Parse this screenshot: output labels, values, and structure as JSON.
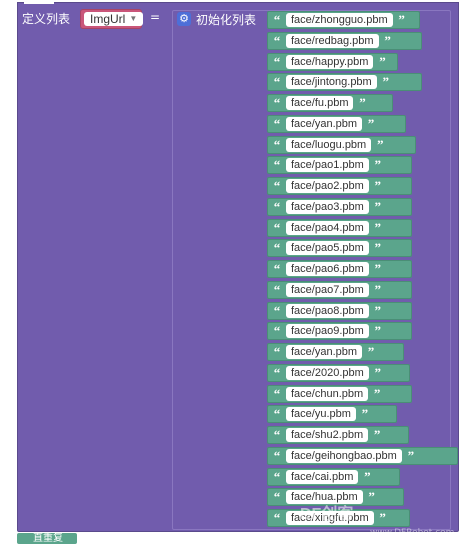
{
  "header": {
    "define_list_label": "定义列表",
    "variable_name": "ImgUrl",
    "equals": "=",
    "init_list_label": "初始化列表"
  },
  "items": [
    "face/zhongguo.pbm",
    "face/redbag.pbm",
    "face/happy.pbm",
    "face/jintong.pbm",
    "face/fu.pbm",
    "face/yan.pbm",
    "face/luogu.pbm",
    "face/pao1.pbm",
    "face/pao2.pbm",
    "face/pao3.pbm",
    "face/pao4.pbm",
    "face/pao5.pbm",
    "face/pao6.pbm",
    "face/pao7.pbm",
    "face/pao8.pbm",
    "face/pao9.pbm",
    "face/yan.pbm",
    "face/2020.pbm",
    "face/chun.pbm",
    "face/yu.pbm",
    "face/shu2.pbm",
    "face/geihongbao.pbm",
    "face/cai.pbm",
    "face/hua.pbm",
    "face/xingfu.pbm"
  ],
  "footer": {
    "next_block_label": "直重复"
  },
  "watermark": {
    "text": "DF创客",
    "sub": "www.DFRobot.com"
  },
  "colors": {
    "list_block": "#715cad",
    "string_block": "#5ba58c",
    "variable_block": "#c9567a"
  }
}
